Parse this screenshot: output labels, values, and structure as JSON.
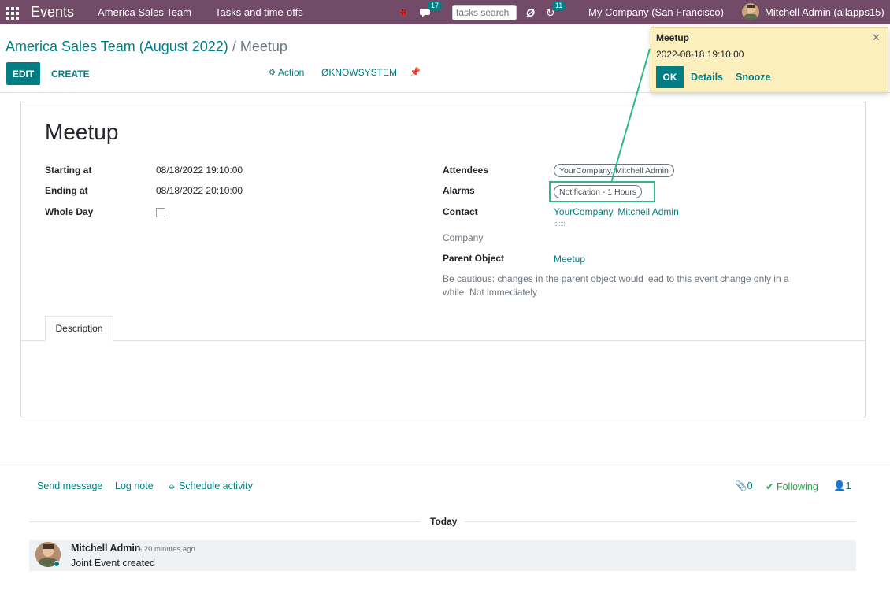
{
  "navbar": {
    "app_name": "Events",
    "menus": [
      "America Sales Team",
      "Tasks and time-offs"
    ],
    "messages_count": "17",
    "search_placeholder": "tasks search",
    "activities_count": "11",
    "company": "My Company (San Francisco)",
    "user": "Mitchell Admin (allapps15)"
  },
  "control_panel": {
    "breadcrumb_parent": "America Sales Team (August 2022)",
    "breadcrumb_sep": " / ",
    "breadcrumb_current": "Meetup",
    "edit_label": "EDIT",
    "create_label": "CREATE",
    "action_label": "Action",
    "knowsystem_label": "KNOWSYSTEM"
  },
  "form": {
    "title": "Meetup",
    "starting_at_label": "Starting at",
    "starting_at": "08/18/2022 19:10:00",
    "ending_at_label": "Ending at",
    "ending_at": "08/18/2022 20:10:00",
    "whole_day_label": "Whole Day",
    "attendees_label": "Attendees",
    "attendee_tag": "YourCompany, Mitchell Admin",
    "alarms_label": "Alarms",
    "alarm_tag": "Notification - 1 Hours",
    "contact_label": "Contact",
    "contact": "YourCompany, Mitchell Admin",
    "company_label": "Company",
    "parent_object_label": "Parent Object",
    "parent_object": "Meetup",
    "caution": "Be cautious: changes in the parent object would lead to this event change only in a while. Not immediately",
    "tab_description": "Description"
  },
  "chatter": {
    "send_message": "Send message",
    "log_note": "Log note",
    "schedule_activity": "Schedule activity",
    "attachments_count": "0",
    "following": "Following",
    "followers_count": "1",
    "date_separator": "Today",
    "message": {
      "author": "Mitchell Admin",
      "time": "- 20 minutes ago",
      "body": "Joint Event created"
    }
  },
  "notification": {
    "title": "Meetup",
    "datetime": "2022-08-18 19:10:00",
    "ok": "OK",
    "details": "Details",
    "snooze": "Snooze"
  },
  "colors": {
    "navbar": "#714b67",
    "primary": "#017e84",
    "highlight": "#2eb889",
    "notification_bg": "#fcefbe"
  }
}
